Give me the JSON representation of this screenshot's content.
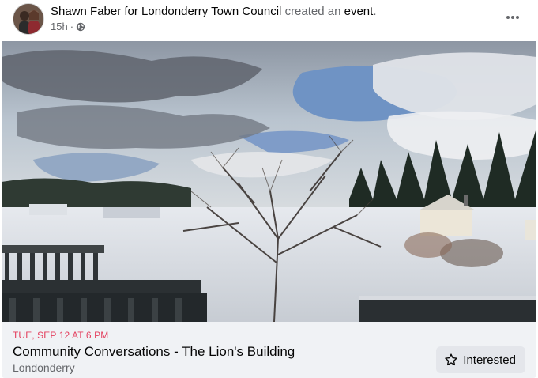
{
  "post": {
    "author": "Shawn Faber for Londonderry Town Council",
    "action_text": "created an",
    "object_text": "event",
    "period": ".",
    "time_ago": "15h",
    "separator": "·",
    "privacy_icon": "globe-icon",
    "more_icon": "more-horizontal-icon"
  },
  "photo": {
    "subject": "winter-landscape-photo"
  },
  "event": {
    "date": "TUE, SEP 12 AT 6 PM",
    "title": "Community Conversations - The Lion's Building",
    "location": "Londonderry",
    "interested_label": "Interested",
    "interested_icon": "star-outline-icon"
  },
  "colors": {
    "date_accent": "#e4405f",
    "card_bg": "#f0f2f5",
    "muted_text": "#65676b",
    "button_bg": "#e4e6eb"
  }
}
